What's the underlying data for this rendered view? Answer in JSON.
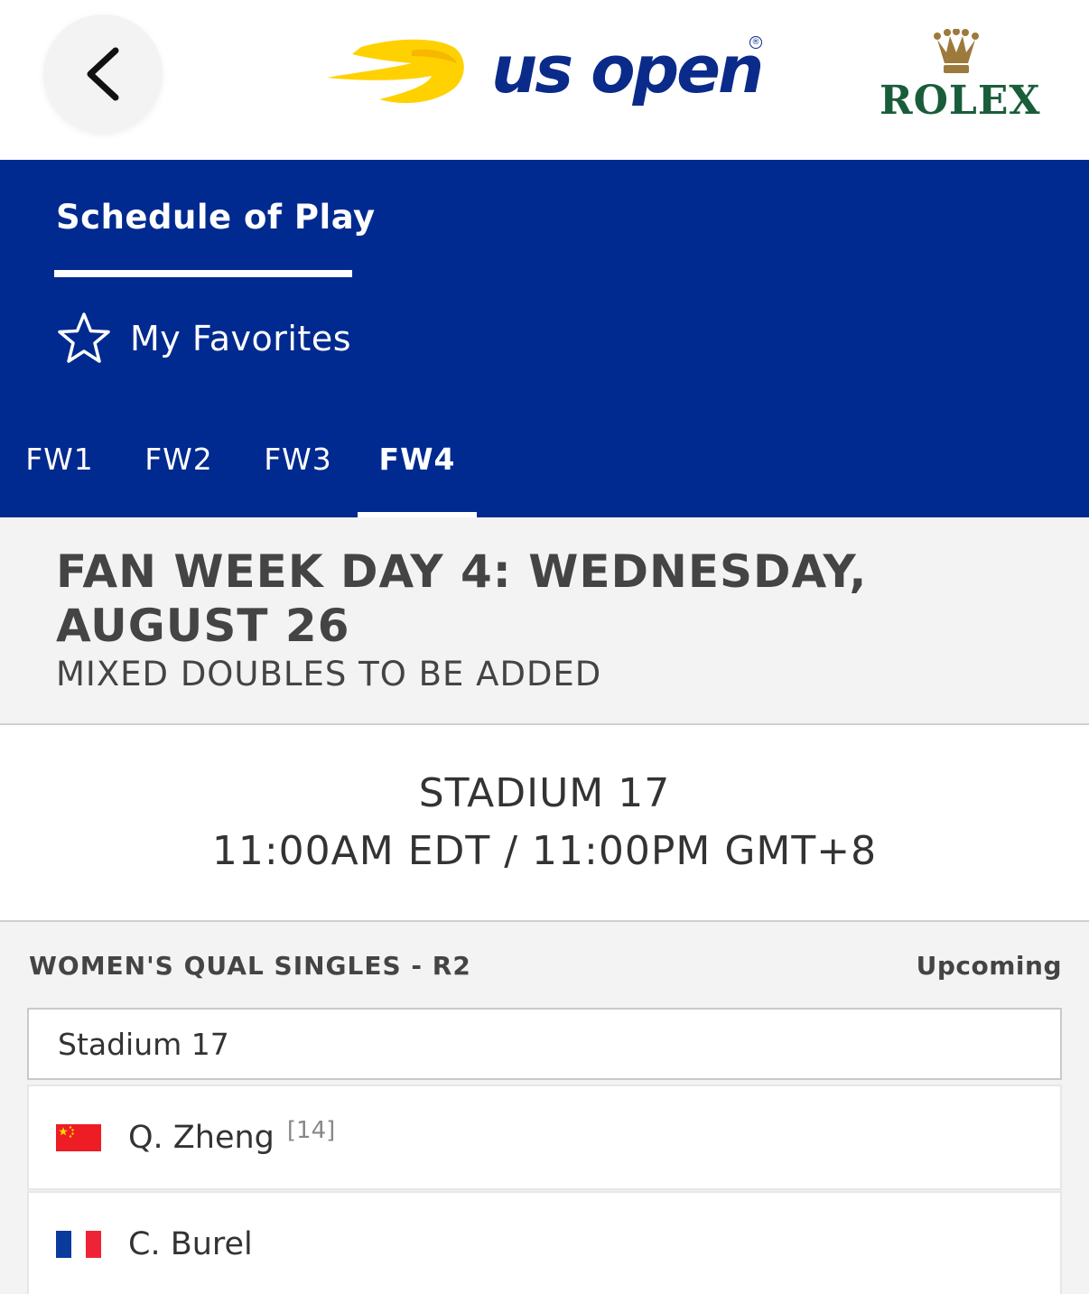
{
  "header": {
    "logo_text": "us open",
    "logo_reg": "®",
    "sponsor_text": "ROLEX"
  },
  "nav": {
    "primary_tab": "Schedule of Play",
    "favorites_label": "My Favorites",
    "day_tabs": [
      {
        "label": "FW1",
        "active": false
      },
      {
        "label": "FW2",
        "active": false
      },
      {
        "label": "FW3",
        "active": false
      },
      {
        "label": "FW4",
        "active": true
      }
    ]
  },
  "day": {
    "title": "FAN WEEK DAY 4: WEDNESDAY, AUGUST 26",
    "subtitle": "MIXED DOUBLES TO BE ADDED"
  },
  "court": {
    "name": "STADIUM 17",
    "time": "11:00AM EDT / 11:00PM GMT+8"
  },
  "match": {
    "event": "WOMEN'S QUAL SINGLES - R2",
    "status": "Upcoming",
    "court": "Stadium 17",
    "players": [
      {
        "name": "Q. Zheng",
        "seed": "[14]",
        "flag": "china-flag"
      },
      {
        "name": "C. Burel",
        "seed": "",
        "flag": "france-flag"
      }
    ]
  },
  "colors": {
    "nav_blue": "#002a8f",
    "logo_blue": "#0a2b8a",
    "logo_yellow": "#ffd100",
    "rolex_green": "#1a5d3a",
    "rolex_gold": "#9c7a3c",
    "section_gray": "#f3f3f3"
  }
}
